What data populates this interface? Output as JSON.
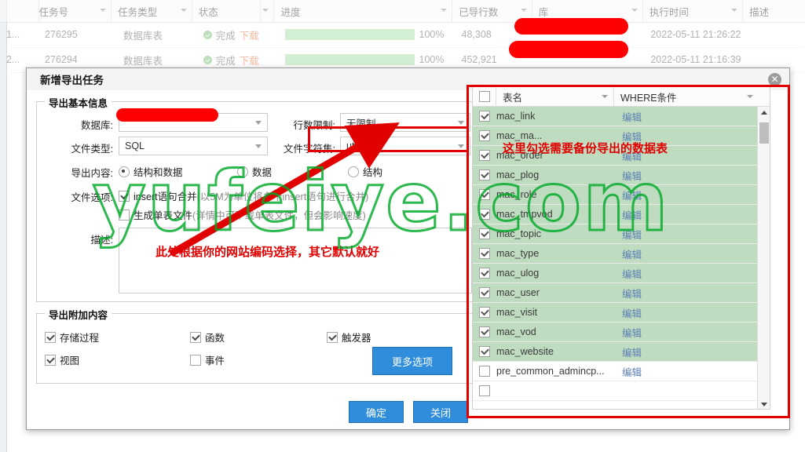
{
  "background_grid": {
    "columns": [
      "",
      "任务号",
      "任务类型",
      "状态",
      "进度",
      "已导行数",
      "库",
      "执行时间",
      "描述"
    ],
    "rows": [
      {
        "idx": "1...",
        "task_no": "276295",
        "task_type": "数据库表",
        "status": "完成",
        "download": "下载",
        "progress": "100%",
        "rows_exported": "48,308",
        "db": "",
        "exec_time": "2022-05-11 21:26:22",
        "desc": ""
      },
      {
        "idx": "2...",
        "task_no": "276294",
        "task_type": "数据库表",
        "status": "完成",
        "download": "下载",
        "progress": "100%",
        "rows_exported": "452,921",
        "db": "",
        "exec_time": "2022-05-11 21:16:39",
        "desc": ""
      }
    ]
  },
  "dialog": {
    "title": "新增导出任务",
    "close_glyph": "✕",
    "basic_group": {
      "legend": "导出基本信息",
      "database_label": "数据库:",
      "database_value": "",
      "row_limit_label": "行数限制:",
      "row_limit_value": "无限制",
      "file_type_label": "文件类型:",
      "file_type_value": "SQL",
      "charset_label": "文件字符集:",
      "charset_value": "utf8",
      "content_label": "导出内容:",
      "content_options": [
        "结构和数据",
        "数据",
        "结构"
      ],
      "content_selected": "结构和数据",
      "file_option_label": "文件选项:",
      "file_options": [
        {
          "label": "insert语句合并",
          "hint": "(以5M为单位将多个insert语句进行合并)",
          "checked": true
        },
        {
          "label": "生成单表文件",
          "hint": "(详情中可下载单表文件，但会影响速度)",
          "checked": false
        }
      ],
      "desc_label": "描述:",
      "desc_value": ""
    },
    "extra_group": {
      "legend": "导出附加内容",
      "items": [
        {
          "label": "存储过程",
          "checked": true
        },
        {
          "label": "函数",
          "checked": true
        },
        {
          "label": "触发器",
          "checked": true
        },
        {
          "label": "视图",
          "checked": true
        },
        {
          "label": "事件",
          "checked": false
        }
      ],
      "more_options_button": "更多选项"
    },
    "table_panel": {
      "columns": [
        "表名",
        "WHERE条件"
      ],
      "edit_label": "编辑",
      "rows": [
        {
          "name": "mac_link",
          "checked": true
        },
        {
          "name": "mac_ma...",
          "checked": true
        },
        {
          "name": "mac_order",
          "checked": true
        },
        {
          "name": "mac_plog",
          "checked": true
        },
        {
          "name": "mac_role",
          "checked": true
        },
        {
          "name": "mac_tmpvod",
          "checked": true
        },
        {
          "name": "mac_topic",
          "checked": true
        },
        {
          "name": "mac_type",
          "checked": true
        },
        {
          "name": "mac_ulog",
          "checked": true
        },
        {
          "name": "mac_user",
          "checked": true
        },
        {
          "name": "mac_visit",
          "checked": true
        },
        {
          "name": "mac_vod",
          "checked": true
        },
        {
          "name": "mac_website",
          "checked": true
        },
        {
          "name": "pre_common_admincp...",
          "checked": false
        },
        {
          "name": "",
          "checked": false
        }
      ]
    },
    "footer": {
      "ok_button": "确定",
      "close_button": "关闭"
    }
  },
  "annotations": {
    "charset_note": "此处根据你的网站编码选择，其它默认就好",
    "table_note": "这里勾选需要备份导出的数据表",
    "watermark": "yufeiye.com",
    "accent_red": "#e00000",
    "watermark_green": "#00aa28",
    "selected_row_green": "#bfdcc0",
    "button_blue": "#2f8ddb"
  }
}
